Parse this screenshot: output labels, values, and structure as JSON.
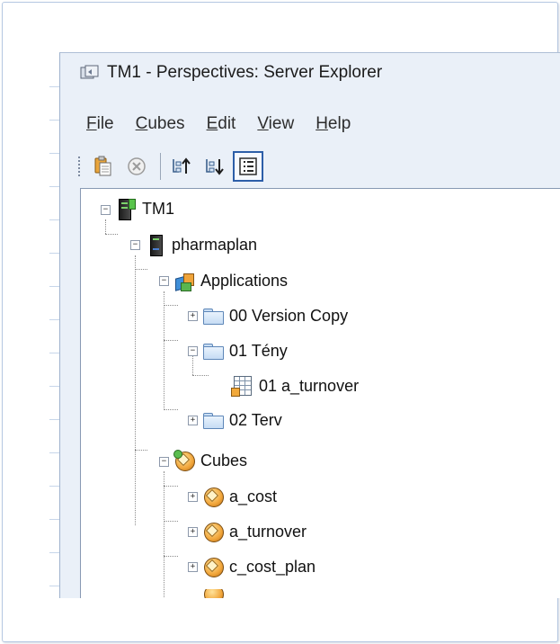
{
  "window": {
    "title": "TM1 - Perspectives: Server Explorer"
  },
  "menu": [
    {
      "label": "File",
      "accel": "F",
      "rest": "ile"
    },
    {
      "label": "Cubes",
      "accel": "C",
      "rest": "ubes"
    },
    {
      "label": "Edit",
      "accel": "E",
      "rest": "dit"
    },
    {
      "label": "View",
      "accel": "V",
      "rest": "iew"
    },
    {
      "label": "Help",
      "accel": "H",
      "rest": "elp"
    }
  ],
  "toolbar": {
    "icons": [
      "paste-icon",
      "stop-icon",
      "sort-ascending-icon",
      "sort-descending-icon",
      "properties-pane-icon"
    ]
  },
  "tree": {
    "root": {
      "label": "TM1",
      "expander": "−"
    },
    "server": {
      "label": "pharmaplan",
      "expander": "−"
    },
    "applications": {
      "label": "Applications",
      "expander": "−"
    },
    "folders": [
      {
        "label": "00 Version Copy",
        "expander": "+"
      },
      {
        "label": "01 Tény",
        "expander": "−"
      },
      {
        "label": "02 Terv",
        "expander": "+"
      }
    ],
    "view_item": {
      "label": "01 a_turnover"
    },
    "cubes": {
      "label": "Cubes",
      "expander": "−"
    },
    "cube_items": [
      {
        "label": "a_cost",
        "expander": "+"
      },
      {
        "label": "a_turnover",
        "expander": "+"
      },
      {
        "label": "c_cost_plan",
        "expander": "+"
      }
    ]
  }
}
